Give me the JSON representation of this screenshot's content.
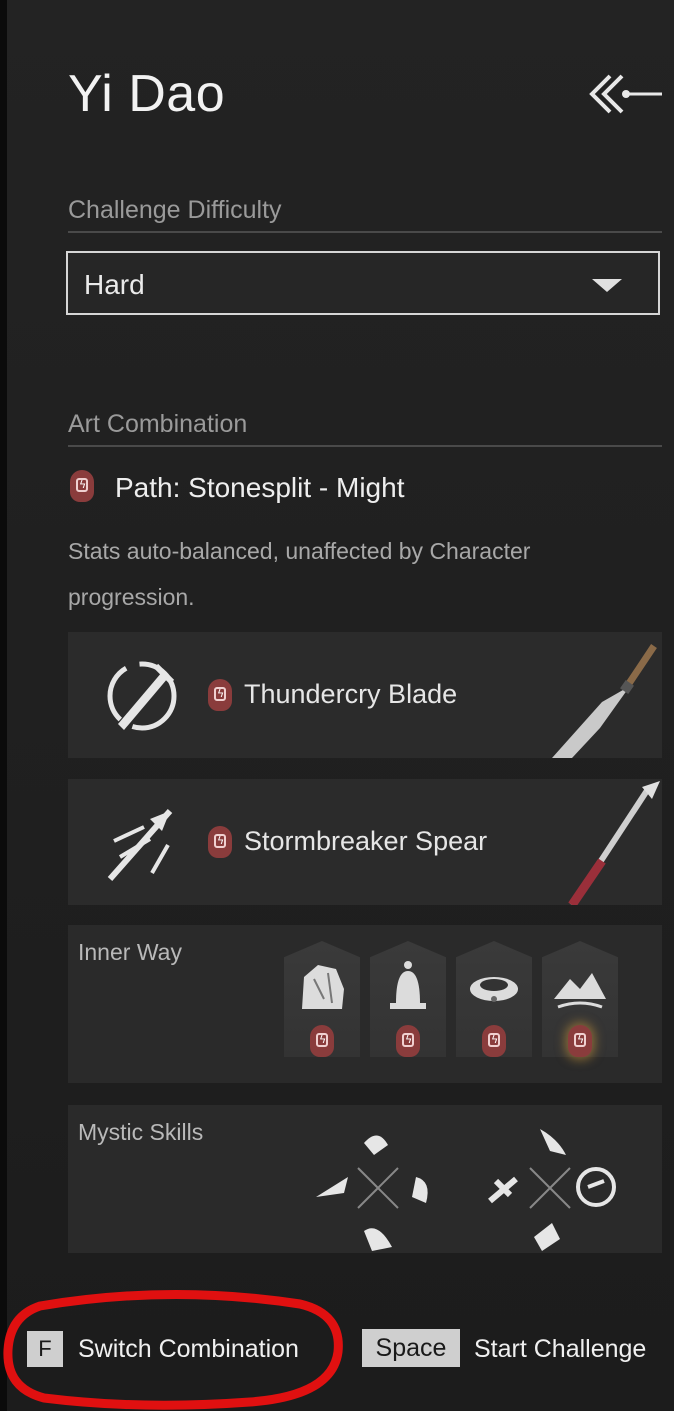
{
  "title": "Yi Dao",
  "back_icon": "back-arrow-icon",
  "difficulty": {
    "label": "Challenge Difficulty",
    "selected": "Hard"
  },
  "art": {
    "label": "Art Combination",
    "path_name": "Path: Stonesplit - Might",
    "description": "Stats auto-balanced, unaffected by Character progression."
  },
  "weapons": [
    {
      "name": "Thundercry Blade",
      "icon": "blade-skill-icon"
    },
    {
      "name": "Stormbreaker Spear",
      "icon": "spear-skill-icon"
    }
  ],
  "inner_way": {
    "label": "Inner Way",
    "slots": [
      "rock-icon",
      "bell-icon",
      "collar-icon",
      "mountain-icon"
    ]
  },
  "mystic_skills": {
    "label": "Mystic Skills"
  },
  "footer": {
    "switch_key": "F",
    "switch_label": "Switch Combination",
    "start_key": "Space",
    "start_label": "Start Challenge"
  },
  "colors": {
    "badge": "#8a3c3c",
    "annotation": "#e01010"
  }
}
